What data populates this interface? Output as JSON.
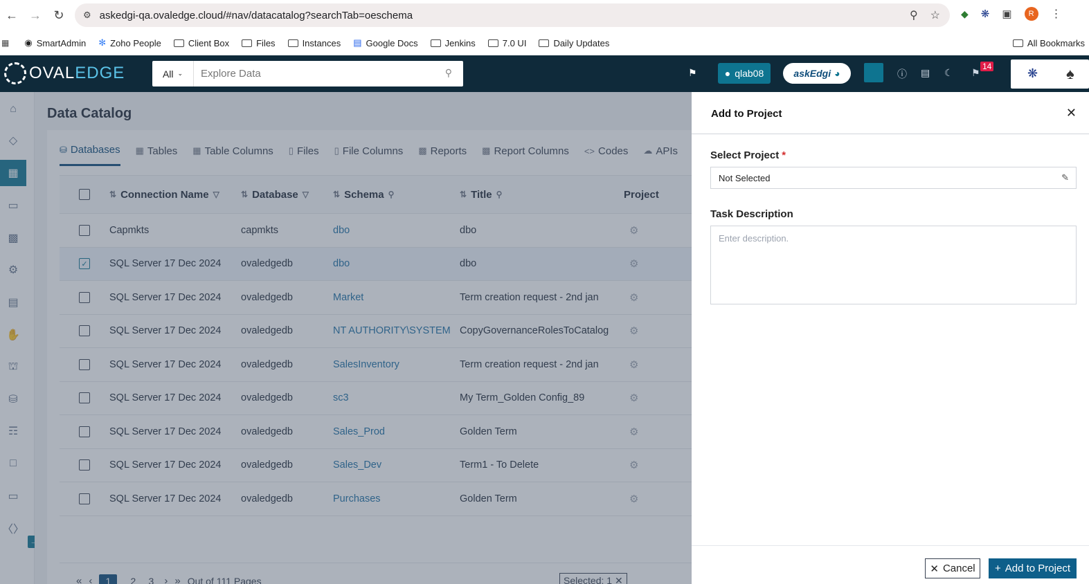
{
  "browser": {
    "url": "askedgi-qa.ovaledge.cloud/#nav/datacatalog?searchTab=oeschema",
    "profile_initial": "R",
    "bookmarks": [
      {
        "label": "SmartAdmin",
        "icon": "github-icon"
      },
      {
        "label": "Zoho People",
        "icon": "zoho-icon"
      },
      {
        "label": "Client Box",
        "icon": "folder-icon"
      },
      {
        "label": "Files",
        "icon": "folder-icon"
      },
      {
        "label": "Instances",
        "icon": "folder-icon"
      },
      {
        "label": "Google Docs",
        "icon": "docs-icon"
      },
      {
        "label": "Jenkins",
        "icon": "folder-icon"
      },
      {
        "label": "7.0 UI",
        "icon": "folder-icon"
      },
      {
        "label": "Daily Updates",
        "icon": "folder-icon"
      }
    ],
    "all_bookmarks": "All Bookmarks"
  },
  "header": {
    "logo_oval": "OVAL",
    "logo_edge": "EDGE",
    "search_scope": "All",
    "search_placeholder": "Explore Data",
    "tenant": "qlab08",
    "askedgi": "askEdgi",
    "notification_count": "14"
  },
  "page": {
    "title": "Data Catalog"
  },
  "tabs": [
    {
      "label": "Databases",
      "icon": "database-icon",
      "active": true
    },
    {
      "label": "Tables",
      "icon": "table-icon"
    },
    {
      "label": "Table Columns",
      "icon": "columns-icon"
    },
    {
      "label": "Files",
      "icon": "file-icon"
    },
    {
      "label": "File Columns",
      "icon": "file-columns-icon"
    },
    {
      "label": "Reports",
      "icon": "report-icon"
    },
    {
      "label": "Report Columns",
      "icon": "report-columns-icon"
    },
    {
      "label": "Codes",
      "icon": "code-icon"
    },
    {
      "label": "APIs",
      "icon": "api-icon"
    }
  ],
  "table": {
    "headers": {
      "connection": "Connection Name",
      "database": "Database",
      "schema": "Schema",
      "title": "Title",
      "project": "Project"
    },
    "rows": [
      {
        "connection": "Capmkts",
        "database": "capmkts",
        "schema": "dbo",
        "title": "dbo",
        "checked": false
      },
      {
        "connection": "SQL Server 17 Dec 2024",
        "database": "ovaledgedb",
        "schema": "dbo",
        "title": "dbo",
        "checked": true
      },
      {
        "connection": "SQL Server 17 Dec 2024",
        "database": "ovaledgedb",
        "schema": "Market",
        "title": "Term creation request - 2nd jan",
        "checked": false
      },
      {
        "connection": "SQL Server 17 Dec 2024",
        "database": "ovaledgedb",
        "schema": "NT AUTHORITY\\SYSTEM",
        "title": "CopyGovernanceRolesToCatalog",
        "checked": false
      },
      {
        "connection": "SQL Server 17 Dec 2024",
        "database": "ovaledgedb",
        "schema": "SalesInventory",
        "title": "Term creation request - 2nd jan",
        "checked": false
      },
      {
        "connection": "SQL Server 17 Dec 2024",
        "database": "ovaledgedb",
        "schema": "sc3",
        "title": "My Term_Golden Config_89",
        "checked": false
      },
      {
        "connection": "SQL Server 17 Dec 2024",
        "database": "ovaledgedb",
        "schema": "Sales_Prod",
        "title": "Golden Term",
        "checked": false
      },
      {
        "connection": "SQL Server 17 Dec 2024",
        "database": "ovaledgedb",
        "schema": "Sales_Dev",
        "title": "Term1 - To Delete",
        "checked": false
      },
      {
        "connection": "SQL Server 17 Dec 2024",
        "database": "ovaledgedb",
        "schema": "Purchases",
        "title": "Golden Term",
        "checked": false
      }
    ]
  },
  "pagination": {
    "pages": [
      "1",
      "2",
      "3"
    ],
    "current": "1",
    "out_of": "Out of 111 Pages",
    "selected": "Selected: 1"
  },
  "drawer": {
    "title": "Add to Project",
    "select_project_label": "Select Project",
    "select_project_value": "Not Selected",
    "task_description_label": "Task Description",
    "task_description_placeholder": "Enter description.",
    "cancel_label": "Cancel",
    "add_label": "Add to Project"
  },
  "colors": {
    "accent": "#0e7490",
    "header_bg": "#0f2a3a",
    "primary_button": "#0e5f8a",
    "link": "#1d6fa5"
  }
}
